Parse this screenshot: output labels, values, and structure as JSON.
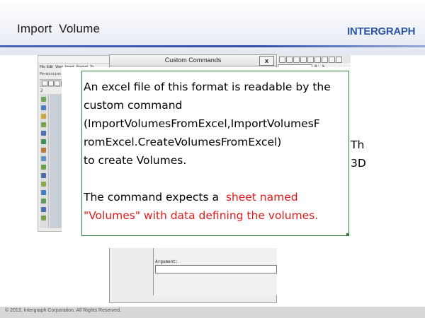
{
  "slide": {
    "title": "Import  Volume",
    "logo": "INTERGRAPH",
    "footer": "© 2013, Intergraph Corporation. All Rights Reserved."
  },
  "app": {
    "menu": [
      "File",
      "Edit",
      "View",
      "Insert",
      "Format",
      "To"
    ],
    "row2": "Permission Gr",
    "row_number": "2"
  },
  "dialog": {
    "title": "Custom Commands",
    "close": "x",
    "argument_label": "Argument:"
  },
  "right_toolbar": {
    "text": "8:  %"
  },
  "callout": {
    "line1": "An excel file of this format is readable by the",
    "line2": "custom command",
    "line3": "(ImportVolumesFromExcel,ImportVolumesF",
    "line4": "romExcel.CreateVolumesFromExcel)",
    "line5": "to create Volumes.",
    "line6_prefix": "The command expects a  ",
    "line6_red": "sheet named",
    "line7_red": "\"Volumes\" with data defining the volumes.",
    "side_line1": "Th",
    "side_line2": "3D"
  },
  "colors": {
    "accent": "#2b56a5",
    "callout_border": "#2f7f3a",
    "highlight_text": "#e21a1a"
  }
}
